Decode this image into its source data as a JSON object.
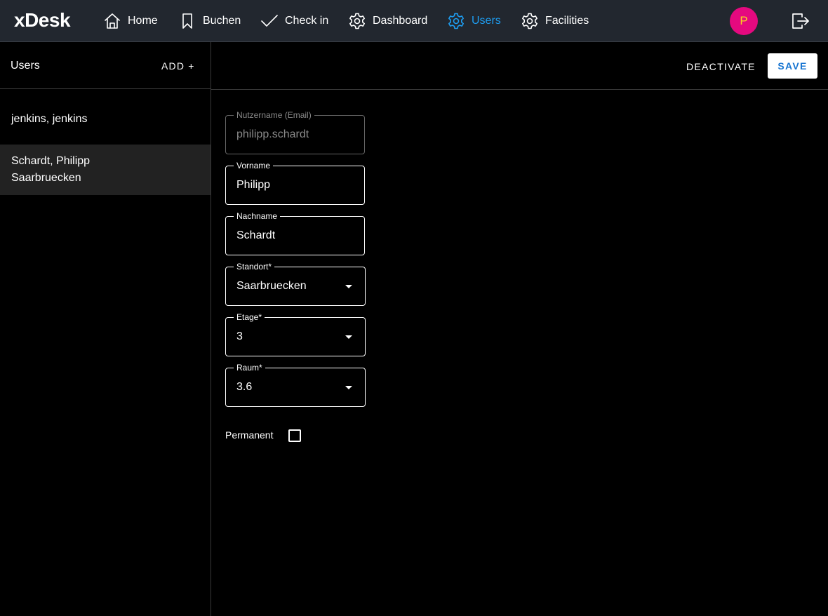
{
  "app": {
    "logo": "xDesk"
  },
  "nav": {
    "home": "Home",
    "book": "Buchen",
    "checkin": "Check in",
    "dashboard": "Dashboard",
    "users": "Users",
    "facilities": "Facilities",
    "active": "Users",
    "active_color": "#1e9df1"
  },
  "avatar": {
    "initial": "P",
    "bg": "#e5097f",
    "fg": "#f7d51d"
  },
  "sidebar": {
    "title": "Users",
    "add_label": "ADD +",
    "users": [
      {
        "line1": "jenkins, jenkins",
        "line2": ""
      },
      {
        "line1": "Schardt, Philipp",
        "line2": "Saarbruecken"
      }
    ]
  },
  "toolbar": {
    "deactivate_label": "DEACTIVATE",
    "save_label": "SAVE"
  },
  "form": {
    "username": {
      "label": "Nutzername (Email)",
      "value": "philipp.schardt"
    },
    "firstname": {
      "label": "Vorname",
      "value": "Philipp"
    },
    "lastname": {
      "label": "Nachname",
      "value": "Schardt"
    },
    "location": {
      "label": "Standort*",
      "value": "Saarbruecken"
    },
    "floor": {
      "label": "Etage*",
      "value": "3"
    },
    "room": {
      "label": "Raum*",
      "value": "3.6"
    },
    "permanent": {
      "label": "Permanent",
      "checked": false
    }
  }
}
